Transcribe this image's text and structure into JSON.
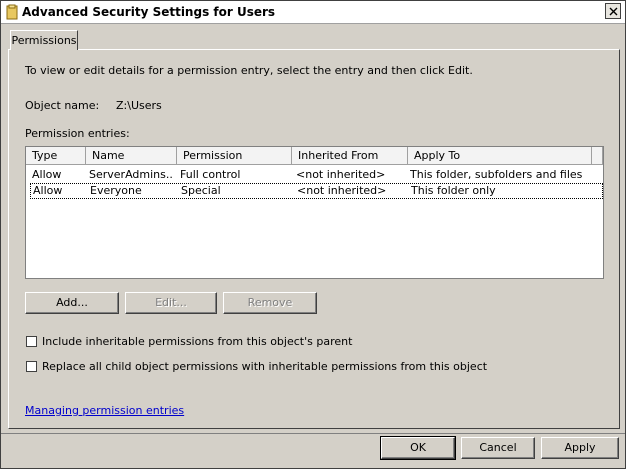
{
  "window": {
    "title": "Advanced Security Settings for Users"
  },
  "tabs": [
    {
      "label": "Permissions"
    }
  ],
  "permissions": {
    "intro_text": "To view or edit details for a permission entry, select the entry and then click Edit.",
    "object_name_label": "Object name:",
    "object_name_value": "Z:\\Users",
    "entries_label": "Permission entries:",
    "columns": [
      "Type",
      "Name",
      "Permission",
      "Inherited From",
      "Apply To"
    ],
    "rows": [
      {
        "type": "Allow",
        "name": "ServerAdmins...",
        "permission": "Full control",
        "inherited": "<not inherited>",
        "apply_to": "This folder, subfolders and files"
      },
      {
        "type": "Allow",
        "name": "Everyone",
        "permission": "Special",
        "inherited": "<not inherited>",
        "apply_to": "This folder only"
      }
    ],
    "buttons": {
      "add": "Add...",
      "edit": "Edit...",
      "remove": "Remove"
    },
    "checkboxes": {
      "include_inheritable": "Include inheritable permissions from this object's parent",
      "replace_child": "Replace all child object permissions with inheritable permissions from this object"
    },
    "link": "Managing permission entries"
  },
  "footer": {
    "ok": "OK",
    "cancel": "Cancel",
    "apply": "Apply"
  },
  "icons": {
    "title_icon": "folder-icon",
    "close": "close-icon"
  }
}
